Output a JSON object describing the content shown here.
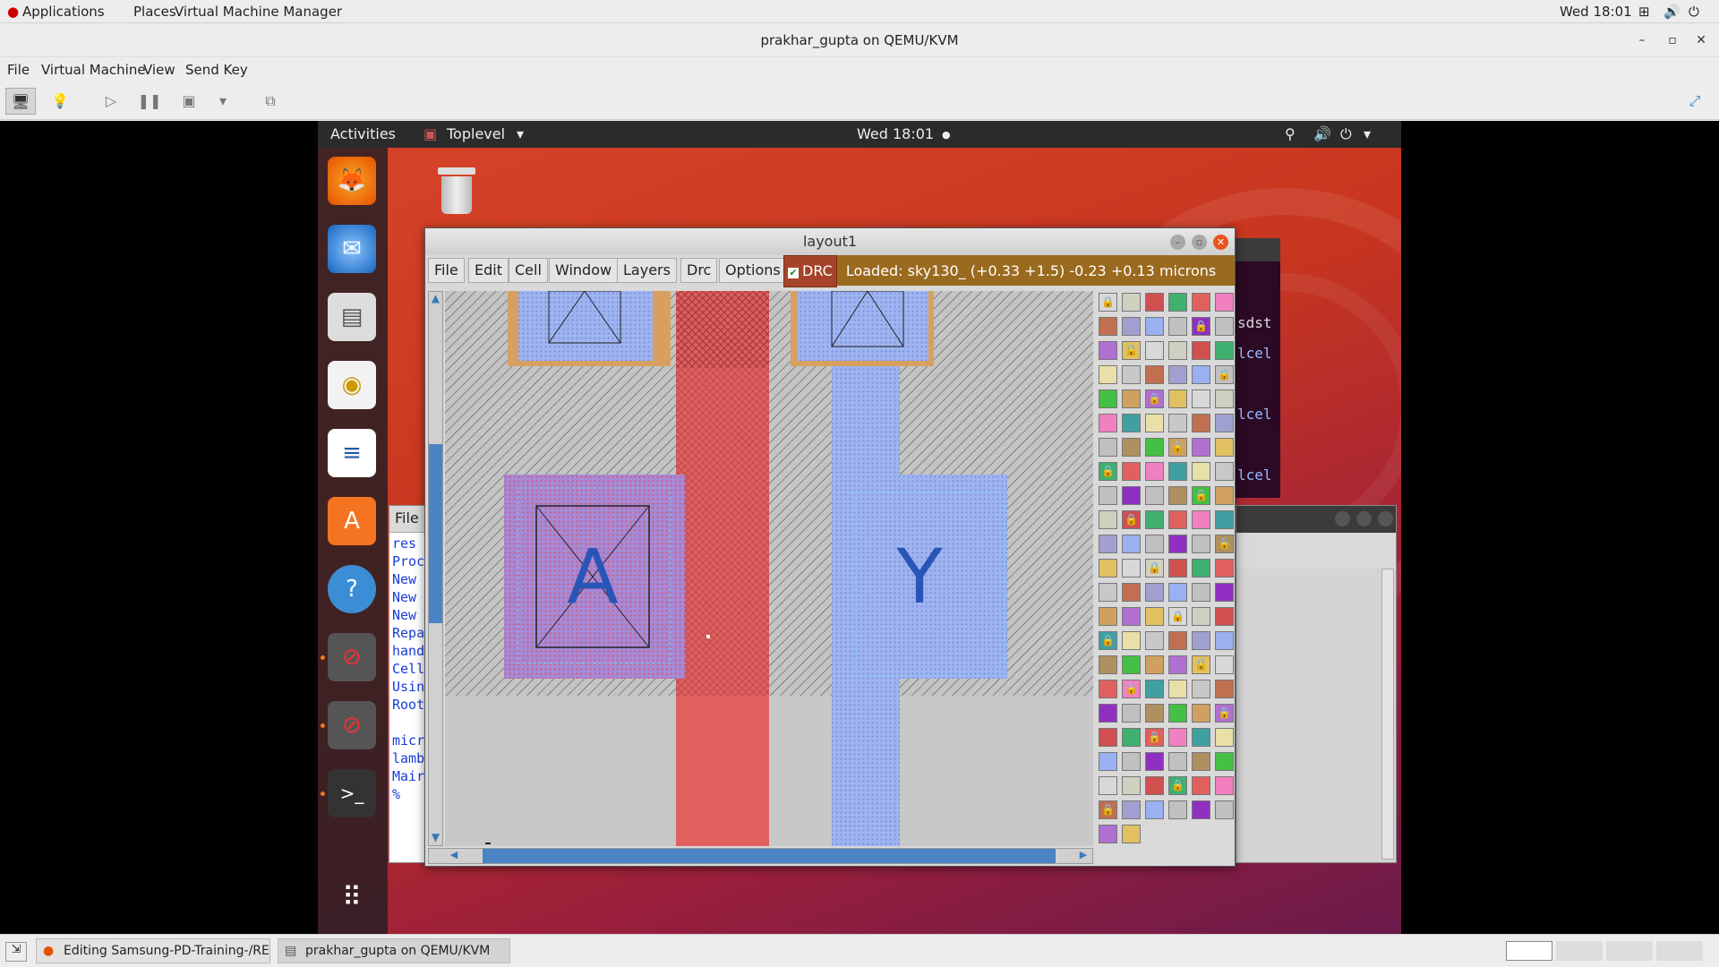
{
  "host_bar": {
    "applications": "Applications",
    "places": "Places",
    "vmm": "Virtual Machine Manager",
    "clock": "Wed 18:01"
  },
  "vm_window": {
    "title": "prakhar_gupta on QEMU/KVM",
    "menu": [
      "File",
      "Virtual Machine",
      "View",
      "Send Key"
    ]
  },
  "guest_panel": {
    "activities": "Activities",
    "app": "Toplevel",
    "clock": "Wed 18:01"
  },
  "layout_window": {
    "title": "layout1",
    "menu": [
      "File",
      "Edit",
      "Cell",
      "Window",
      "Layers",
      "Drc",
      "Options"
    ],
    "drc_label": "DRC",
    "drc_checked": true,
    "status": "Loaded: sky130_    (+0.33 +1.5) -0.23 +0.13 microns",
    "label_a": "A",
    "label_y": "Y"
  },
  "bg_text_window": {
    "menu_label": "File",
    "lines": [
      "res",
      "Proc",
      "New",
      "New",
      "New",
      "Repa",
      "hand",
      "Cell",
      "Usin",
      "Root",
      "",
      "micr",
      "lamb",
      "Mair",
      "%"
    ]
  },
  "terminal_fragments": [
    "sdst",
    "lcel",
    "lcel",
    "lcel"
  ],
  "taskbar": {
    "task1": "Editing Samsung-PD-Training-/READ...",
    "task2": "prakhar_gupta on QEMU/KVM"
  },
  "colors": {
    "ubuntu_orange": "#e95420",
    "status_bar": "#9a6a1e",
    "poly_red": "#e06060",
    "metal_blue": "#8fa8f0"
  }
}
